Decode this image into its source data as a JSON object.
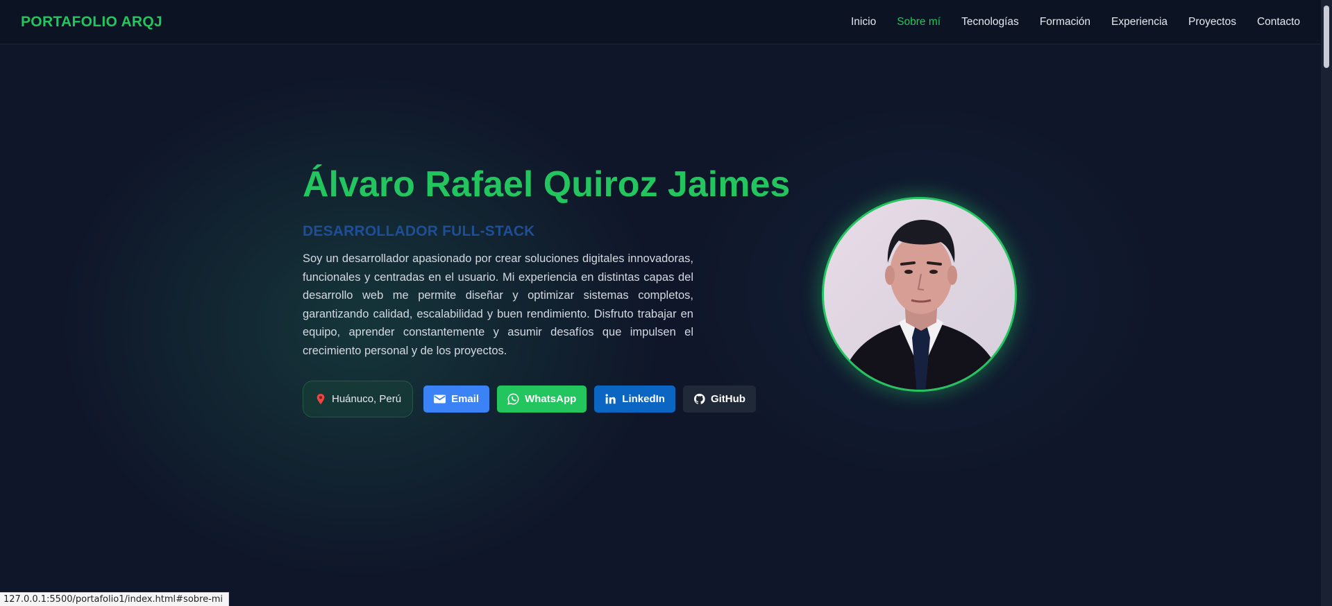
{
  "nav": {
    "brand": "PORTAFOLIO ARQJ",
    "links": [
      "Inicio",
      "Sobre mí",
      "Tecnologías",
      "Formación",
      "Experiencia",
      "Proyectos",
      "Contacto"
    ],
    "active_index": 1
  },
  "hero": {
    "name": "Álvaro Rafael Quiroz Jaimes",
    "role": "DESARROLLADOR FULL-STACK",
    "description": "Soy un desarrollador apasionado por crear soluciones digitales innovadoras, funcionales y centradas en el usuario. Mi experiencia en distintas capas del desarrollo web me permite diseñar y optimizar sistemas completos, garantizando calidad, escalabilidad y buen rendimiento. Disfruto trabajar en equipo, aprender constantemente y asumir desafíos que impulsen el crecimiento personal y de los proyectos.",
    "location": "Huánuco, Perú",
    "buttons": {
      "email": "Email",
      "whatsapp": "WhatsApp",
      "linkedin": "LinkedIn",
      "github": "GitHub"
    }
  },
  "status_bar": {
    "url": "127.0.0.1:5500/portafolio1/index.html#sobre-mi"
  },
  "colors": {
    "accent": "#22c55e",
    "role": "#1e4f96",
    "email": "#3b82f6",
    "whatsapp": "#22c55e",
    "linkedin": "#0a66c2",
    "github": "#1f2937",
    "background": "#0f1629"
  },
  "icons": [
    "pin-icon",
    "mail-icon",
    "whatsapp-icon",
    "linkedin-icon",
    "github-icon"
  ]
}
